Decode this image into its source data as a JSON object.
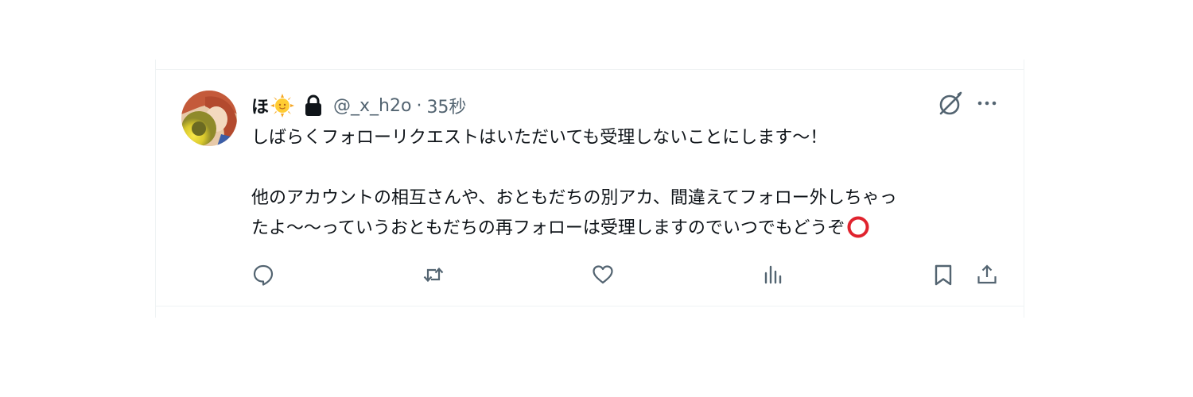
{
  "tweet": {
    "display_name": "ほ",
    "handle": "@_x_h2o",
    "separator": "·",
    "time": "35秒",
    "body_line_1": "しばらくフォローリクエストはいただいても受理しないことにします〜！",
    "body_line_2": "",
    "body_line_3": "他のアカウントの相互さんや、おともだちの別アカ、間違えてフォロー外しちゃっ",
    "body_line_4": "たよ〜〜っていうおともだちの再フォローは受理しますのでいつでもどうぞ",
    "emoji_after_name": "sun-emoji",
    "emoji_end": "red-circle-emoji",
    "protected_account": true
  },
  "actions": [
    {
      "name": "reply",
      "icon": "reply-icon"
    },
    {
      "name": "retweet",
      "icon": "retweet-icon"
    },
    {
      "name": "like",
      "icon": "heart-icon"
    },
    {
      "name": "views",
      "icon": "analytics-icon"
    },
    {
      "name": "bookmark",
      "icon": "bookmark-icon"
    },
    {
      "name": "share",
      "icon": "share-icon"
    }
  ],
  "colors": {
    "text_primary": "#0f1419",
    "text_secondary": "#536471",
    "border": "#eff3f4",
    "circle_red": "#e0232e"
  }
}
